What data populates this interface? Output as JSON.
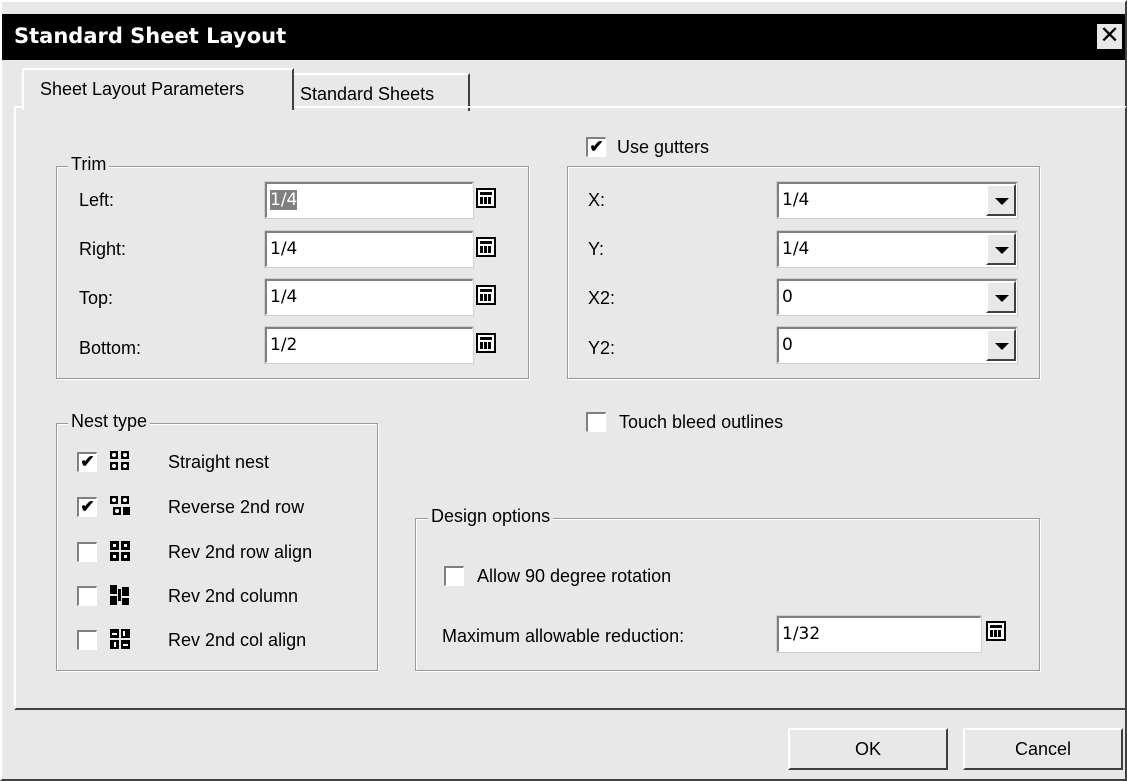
{
  "window": {
    "title": "Standard Sheet Layout",
    "close_glyph": "✕"
  },
  "tabs": [
    {
      "label": "Sheet Layout Parameters",
      "active": true
    },
    {
      "label": "Standard Sheets",
      "active": false
    }
  ],
  "trim": {
    "legend": "Trim",
    "left_label": "Left:",
    "left_value": "1/4",
    "right_label": "Right:",
    "right_value": "1/4",
    "top_label": "Top:",
    "top_value": "1/4",
    "bottom_label": "Bottom:",
    "bottom_value": "1/2"
  },
  "gutters": {
    "checkbox_label": "Use gutters",
    "checked": true,
    "check_glyph": "✔",
    "x_label": "X:",
    "x_value": "1/4",
    "y_label": "Y:",
    "y_value": "1/4",
    "x2_label": "X2:",
    "x2_value": "0",
    "y2_label": "Y2:",
    "y2_value": "0"
  },
  "touch_bleed": {
    "label": "Touch bleed outlines",
    "checked": false
  },
  "nest_type": {
    "legend": "Nest type",
    "check_glyph": "✔",
    "items": [
      {
        "label": "Straight nest",
        "checked": true,
        "icon": "straight-nest-icon"
      },
      {
        "label": "Reverse 2nd row",
        "checked": true,
        "icon": "reverse-2nd-row-icon"
      },
      {
        "label": "Rev 2nd row align",
        "checked": false,
        "icon": "rev-2nd-row-align-icon"
      },
      {
        "label": "Rev 2nd column",
        "checked": false,
        "icon": "rev-2nd-column-icon"
      },
      {
        "label": "Rev 2nd col align",
        "checked": false,
        "icon": "rev-2nd-col-align-icon"
      }
    ]
  },
  "design_options": {
    "legend": "Design options",
    "rotation_label": "Allow 90 degree rotation",
    "rotation_checked": false,
    "reduction_label": "Maximum allowable reduction:",
    "reduction_value": "1/32"
  },
  "buttons": {
    "ok": "OK",
    "cancel": "Cancel"
  }
}
